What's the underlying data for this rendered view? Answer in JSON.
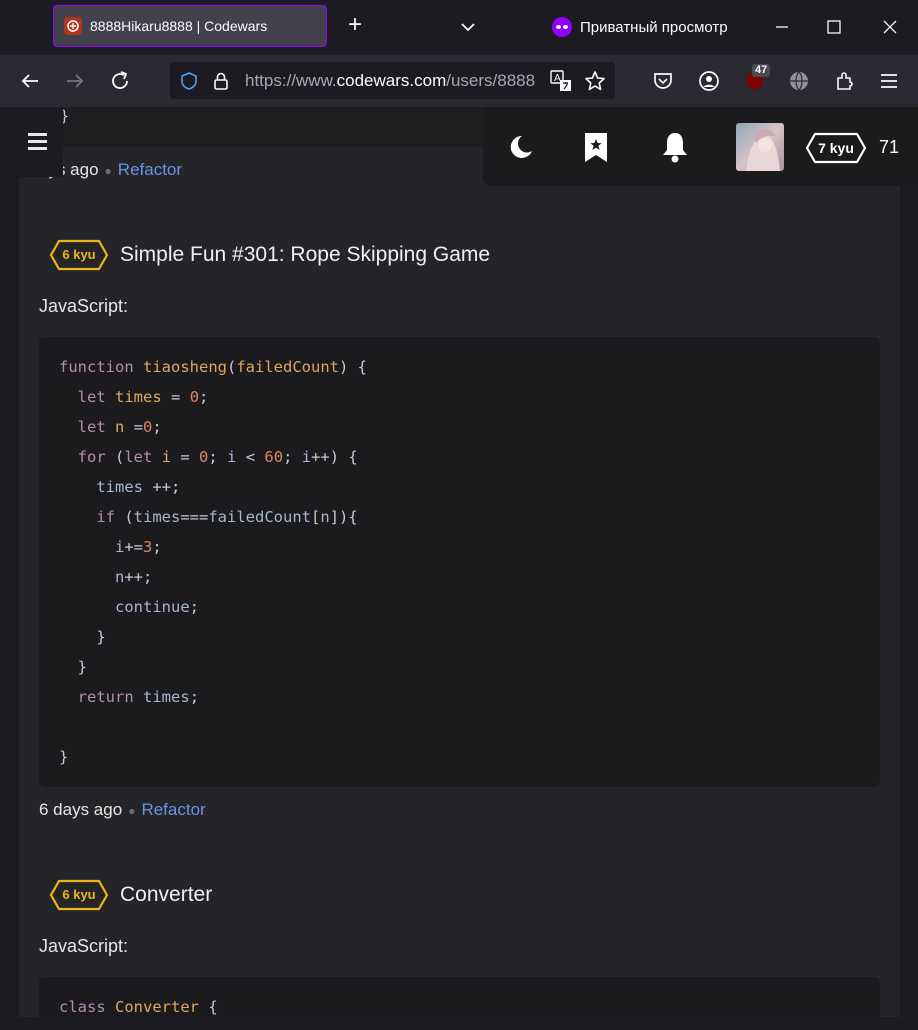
{
  "browser": {
    "tab_title": "8888Hikaru8888 | Codewars",
    "private_label": "Приватный просмотр",
    "url_prefix": "https://www.",
    "url_host": "codewars.com",
    "url_path": "/users/8888",
    "extension_badge": "47",
    "accent_color": "#8f00ff"
  },
  "header": {
    "rank": "7 kyu",
    "honor": "71"
  },
  "feed": {
    "top_brace": "}",
    "top_meta_time": "ays ago",
    "top_meta_action": "Refactor",
    "solutions": [
      {
        "kyu": "6 kyu",
        "title": "Simple Fun #301: Rope Skipping Game",
        "language": "JavaScript:",
        "time": "6 days ago",
        "action": "Refactor"
      },
      {
        "kyu": "6 kyu",
        "title": "Converter",
        "language": "JavaScript:",
        "code_first_line": "class Converter {"
      }
    ]
  },
  "colors": {
    "kyu_yellow": "#ecb613",
    "link": "#6795de"
  }
}
